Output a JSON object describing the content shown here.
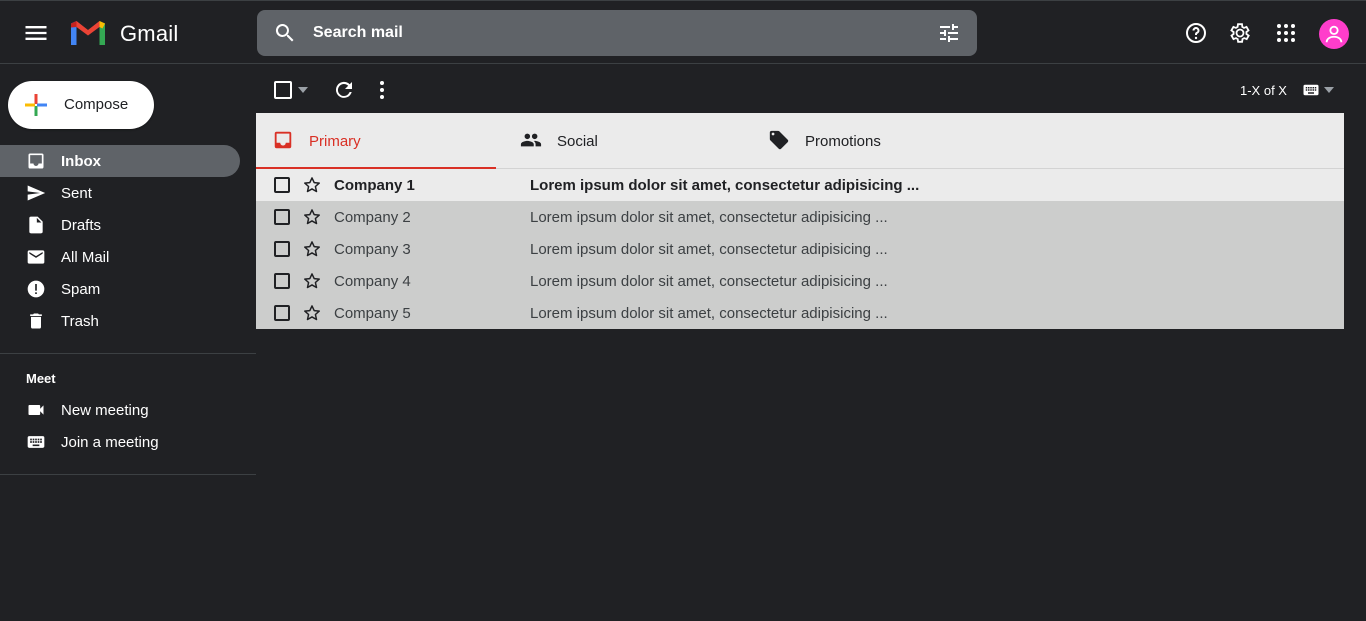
{
  "header": {
    "brand": "Gmail",
    "search_placeholder": "Search mail"
  },
  "sidebar": {
    "compose_label": "Compose",
    "items": [
      {
        "label": "Inbox",
        "icon": "inbox-icon",
        "active": true
      },
      {
        "label": "Sent",
        "icon": "send-icon"
      },
      {
        "label": "Drafts",
        "icon": "draft-icon"
      },
      {
        "label": "All Mail",
        "icon": "mail-icon"
      },
      {
        "label": "Spam",
        "icon": "spam-icon"
      },
      {
        "label": "Trash",
        "icon": "trash-icon"
      }
    ],
    "meet": {
      "title": "Meet",
      "items": [
        {
          "label": "New meeting",
          "icon": "video-icon"
        },
        {
          "label": "Join a meeting",
          "icon": "keyboard-icon"
        }
      ]
    }
  },
  "toolbar": {
    "pager": "1-X of X"
  },
  "tabs": [
    {
      "label": "Primary",
      "icon": "inbox-icon",
      "active": true
    },
    {
      "label": "Social",
      "icon": "people-icon"
    },
    {
      "label": "Promotions",
      "icon": "tag-icon"
    }
  ],
  "emails": [
    {
      "sender": "Company 1",
      "subject": "Lorem ipsum dolor sit amet, consectetur adipisicing ...",
      "unread": true
    },
    {
      "sender": "Company 2",
      "subject": "Lorem ipsum dolor sit amet, consectetur adipisicing ..."
    },
    {
      "sender": "Company 3",
      "subject": "Lorem ipsum dolor sit amet, consectetur adipisicing ..."
    },
    {
      "sender": "Company 4",
      "subject": "Lorem ipsum dolor sit amet, consectetur adipisicing ..."
    },
    {
      "sender": "Company 5",
      "subject": "Lorem ipsum dolor sit amet, consectetur adipisicing ..."
    }
  ],
  "colors": {
    "background": "#202124",
    "accent_red": "#d93025",
    "avatar": "#ff3dcb",
    "search_bg": "#5f6368"
  }
}
